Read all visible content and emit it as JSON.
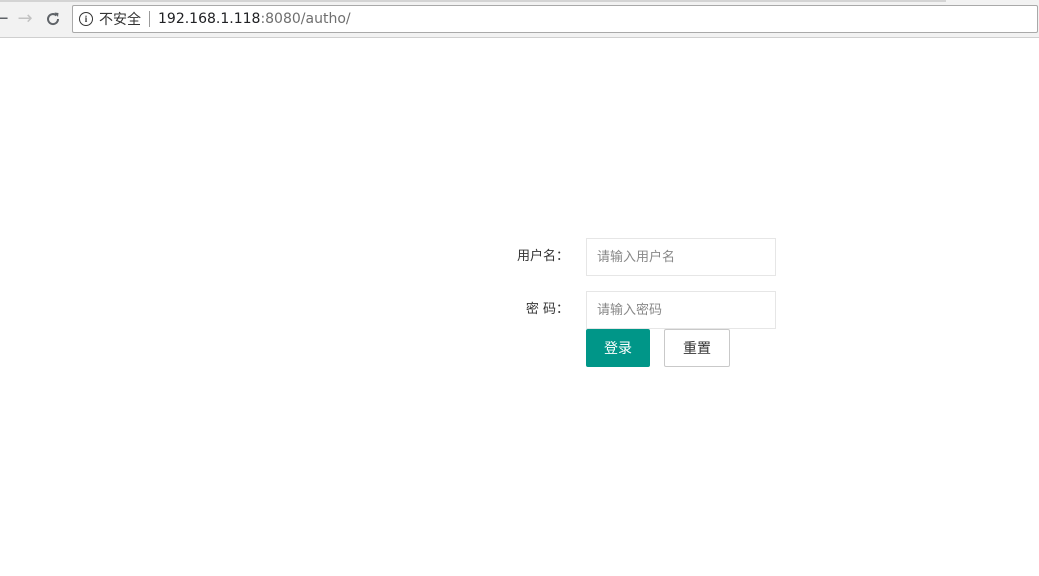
{
  "browser": {
    "security_label": "不安全",
    "url_host": "192.168.1.118",
    "url_rest": ":8080/autho/",
    "back_icon": "arrow-left-icon",
    "forward_icon": "arrow-right-icon",
    "reload_icon": "reload-icon",
    "info_icon": "info-icon"
  },
  "form": {
    "username_label": "用户名：",
    "username_placeholder": "请输入用户名",
    "username_value": "",
    "password_label": "密 码：",
    "password_placeholder": "请输入密码",
    "password_value": "",
    "login_label": "登录",
    "reset_label": "重置"
  },
  "colors": {
    "primary": "#009688",
    "border": "#e6e6e6"
  }
}
